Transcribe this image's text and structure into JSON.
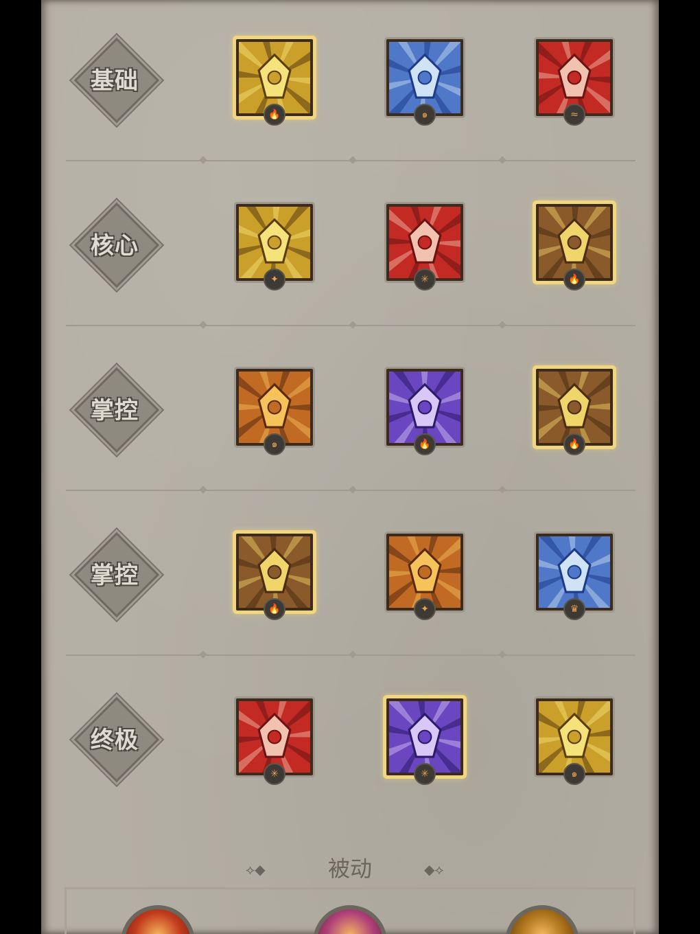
{
  "tiers": [
    {
      "label": "基础",
      "skills": [
        {
          "name": "golden-axe-skill",
          "palette": "gold",
          "selected": true,
          "rune_icon": "flame-rune-icon"
        },
        {
          "name": "frost-blade-skill",
          "palette": "blue",
          "selected": false,
          "rune_icon": "swirl-rune-icon"
        },
        {
          "name": "red-hammer-skill",
          "palette": "red",
          "selected": false,
          "rune_icon": "wind-rune-icon"
        }
      ]
    },
    {
      "label": "核心",
      "skills": [
        {
          "name": "whirlwind-skill",
          "palette": "gold",
          "selected": false,
          "rune_icon": "star-rune-icon"
        },
        {
          "name": "rend-skill",
          "palette": "red",
          "selected": false,
          "rune_icon": "spike-rune-icon"
        },
        {
          "name": "totem-skill",
          "palette": "brown",
          "selected": true,
          "rune_icon": "flame-rune-icon"
        }
      ]
    },
    {
      "label": "掌控",
      "skills": [
        {
          "name": "comet-strike-skill",
          "palette": "orange",
          "selected": false,
          "rune_icon": "swirl-rune-icon"
        },
        {
          "name": "void-burst-skill",
          "palette": "purple",
          "selected": false,
          "rune_icon": "flame-rune-icon"
        },
        {
          "name": "ground-slam-skill",
          "palette": "brown",
          "selected": true,
          "rune_icon": "flame-rune-icon"
        }
      ]
    },
    {
      "label": "掌控",
      "skills": [
        {
          "name": "iron-fist-skill",
          "palette": "brown",
          "selected": true,
          "rune_icon": "flame-rune-icon"
        },
        {
          "name": "war-cry-skill",
          "palette": "orange",
          "selected": false,
          "rune_icon": "star-rune-icon"
        },
        {
          "name": "frost-cry-skill",
          "palette": "blue",
          "selected": false,
          "rune_icon": "crown-rune-icon"
        }
      ]
    },
    {
      "label": "终极",
      "skills": [
        {
          "name": "dragon-fury-skill",
          "palette": "red",
          "selected": false,
          "rune_icon": "spike-rune-icon"
        },
        {
          "name": "demon-form-skill",
          "palette": "purple",
          "selected": true,
          "rune_icon": "spike-rune-icon"
        },
        {
          "name": "golden-rage-skill",
          "palette": "gold",
          "selected": false,
          "rune_icon": "swirl-rune-icon"
        }
      ]
    }
  ],
  "passive": {
    "title": "被动",
    "orbs": [
      {
        "name": "fire-passive-orb",
        "color": "#c23a1c"
      },
      {
        "name": "heart-passive-orb",
        "color": "#b0407a"
      },
      {
        "name": "gold-passive-orb",
        "color": "#a87018"
      }
    ]
  },
  "palettes": {
    "gold": [
      "#5a3d10",
      "#caa02a",
      "#f5e27a"
    ],
    "blue": [
      "#1f3a8a",
      "#4f78c8",
      "#cfe3f4"
    ],
    "red": [
      "#6a1414",
      "#c42a24",
      "#f2c2b0"
    ],
    "brown": [
      "#4a2d14",
      "#8a5a2a",
      "#f0d56a"
    ],
    "orange": [
      "#5a2a10",
      "#c06a24",
      "#f6c25a"
    ],
    "purple": [
      "#2c1a6a",
      "#6a46c0",
      "#d8c8f6"
    ]
  }
}
